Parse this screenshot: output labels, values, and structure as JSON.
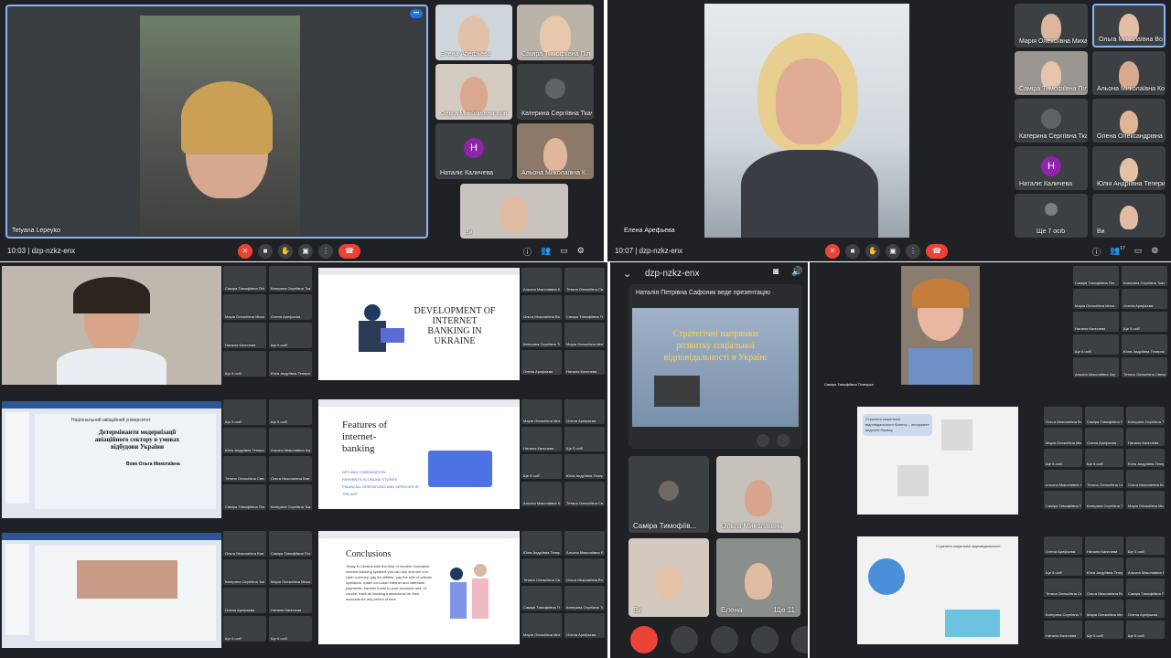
{
  "colors": {
    "background": "#202124",
    "tile": "#3c4043",
    "red": "#ea4335",
    "accent": "#8ab4f8"
  },
  "meeting_code": "dzp-nzkz-enx",
  "q1": {
    "main_name": "Tetyana Lepeyko",
    "time": "10:03",
    "more_icon": "•••",
    "tiles": [
      {
        "name": "Елена Арефьева"
      },
      {
        "name": "Саміра Тимофіївна Піл"
      },
      {
        "name": "Ольга Миколаївна Вов"
      },
      {
        "name": "Катерина Сергіївна Ткач"
      },
      {
        "name": "Наталіє Каличева",
        "initial": "H",
        "color": "#8e24aa"
      },
      {
        "name": "Альона Миколаївна К..."
      },
      {
        "name": "Ви"
      }
    ]
  },
  "q2": {
    "main_name": "Елена Арефьева",
    "time": "10:07",
    "count": "17",
    "tiles": [
      {
        "name": "Марія Олексіївна Миха..."
      },
      {
        "name": "Ольга Миколаївна Воль"
      },
      {
        "name": "Саміра Тимофіївна Піл"
      },
      {
        "name": "Альона Миколаївна Кор"
      },
      {
        "name": "Катерина Сергіївна Ткач"
      },
      {
        "name": "Олена Олександрівна ..."
      },
      {
        "name": "Наталіє Каличева",
        "initial": "H",
        "color": "#8e24aa"
      },
      {
        "name": "Юлія Андріївна Теперик"
      },
      {
        "name": "Ще 7 осіб"
      },
      {
        "name": "Ви"
      }
    ]
  },
  "phone": {
    "title": "dzp-nzkz-enx",
    "presenter": "Наталія Петрівна Сафоник веде презентацію",
    "slide_title": "Стратегічні напрямки розвитку соціальної відповідальності в Україні",
    "tiles": [
      {
        "name": "Саміра Тимофіїв..."
      },
      {
        "name": "Ольга Миколаївна"
      },
      {
        "name": "Ви"
      },
      {
        "name": "Елена"
      },
      {
        "name": "Ще 11"
      }
    ]
  },
  "slides": {
    "s1": "DEVELOPMENT OF INTERNET BANKING IN UKRAINE",
    "s2_title": "Features of internet-banking",
    "s2_items": [
      "NFS AND TOKENIZATION",
      "PAYMENTS IN ONLINE STORES",
      "FINANCIAL OPERATIONS AND SERVICES IN THE APP"
    ],
    "s3_title": "Conclusions",
    "s3_body": "Today in Ukraine with the help of modern innovative Internet banking systems you can buy and sell non-cash currency, pay for utilities, pay the bills of cellular operators, make non-cash internet and interbank payments, transfer funds to your accounts and, of course, track all banking transactions on their accounts for any period of time.",
    "ppt1_title": "Детермінанти модернізації авіаційного сектору в умовах відбудови України",
    "ppt1_author": "Вовк Ольга Миколаївна",
    "ppt1_univ": "Національний авіаційний університет"
  },
  "q4": {
    "main_name": "Саміра Тимофіївна Пілецька",
    "slide1": "Стратегія соціальної відповідальності бізнесу – інструмент ведення бізнесу",
    "slide2": "Стратегія соціальної відповідальності"
  },
  "mini_names": [
    "Саміра Тимофіївна Піл",
    "Катерина Сергіївна Ткач",
    "Марія Олексіївна Миха",
    "Олена Арефьєва",
    "Наталія Каличева",
    "Ще 5 осіб",
    "Ще 8 осіб",
    "Юлія Андріївна Теперик",
    "Альона Миколаївна Кор",
    "Тетяна Олексіївна Свєсик",
    "Ольга Миколаївна Вов"
  ]
}
